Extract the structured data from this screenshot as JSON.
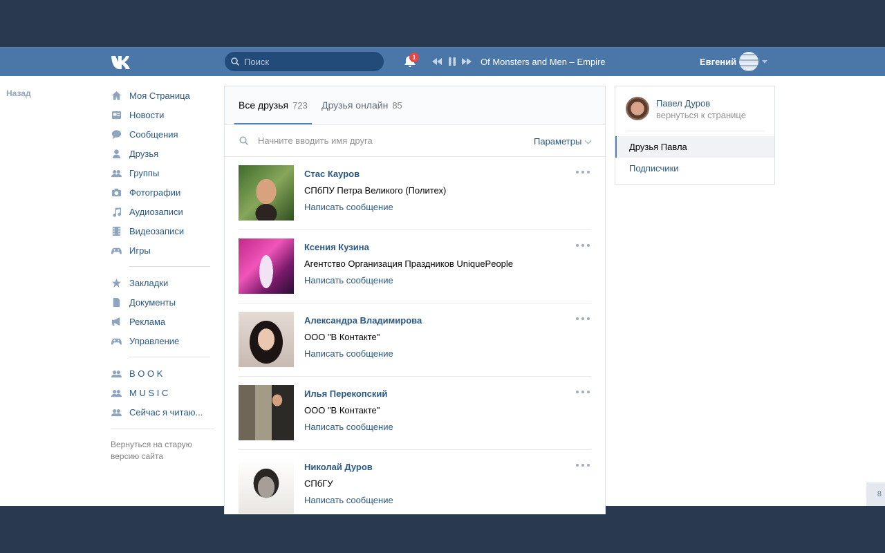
{
  "header": {
    "search_placeholder": "Поиск",
    "notifications_count": "1",
    "now_playing": "Of Monsters and Men – Empire",
    "user_name": "Евгений"
  },
  "back_link": "Назад",
  "sidebar": {
    "main": [
      {
        "label": "Моя Страница",
        "icon": "home-icon"
      },
      {
        "label": "Новости",
        "icon": "news-icon"
      },
      {
        "label": "Сообщения",
        "icon": "messages-icon"
      },
      {
        "label": "Друзья",
        "icon": "friends-icon"
      },
      {
        "label": "Группы",
        "icon": "groups-icon"
      },
      {
        "label": "Фотографии",
        "icon": "camera-icon"
      },
      {
        "label": "Аудиозаписи",
        "icon": "music-note-icon"
      },
      {
        "label": "Видеозаписи",
        "icon": "film-icon"
      },
      {
        "label": "Игры",
        "icon": "gamepad-icon"
      }
    ],
    "secondary": [
      {
        "label": "Закладки",
        "icon": "star-icon"
      },
      {
        "label": "Документы",
        "icon": "document-icon"
      },
      {
        "label": "Реклама",
        "icon": "megaphone-icon"
      },
      {
        "label": "Управление",
        "icon": "gamepad-icon"
      }
    ],
    "groups": [
      {
        "label": "B O O K",
        "icon": "group-icon"
      },
      {
        "label": "M U S I C",
        "icon": "group-icon"
      },
      {
        "label": "Сейчас я читаю...",
        "icon": "group-icon"
      }
    ],
    "old_version": "Вернуться на старую версию сайта"
  },
  "friends": {
    "tabs": [
      {
        "label": "Все друзья",
        "count": "723"
      },
      {
        "label": "Друзья онлайн",
        "count": "85"
      }
    ],
    "filter_placeholder": "Начните вводить имя друга",
    "params_label": "Параметры",
    "items": [
      {
        "name": "Стас Кауров",
        "info": "СПбПУ Петра Великого (Политех)",
        "action": "Написать сообщение"
      },
      {
        "name": "Ксения Кузина",
        "info": "Агентство Организация Праздников UniquePeople",
        "action": "Написать сообщение"
      },
      {
        "name": "Александра Владимирова",
        "info": "ООО \"В Контакте\"",
        "action": "Написать сообщение"
      },
      {
        "name": "Илья Перекопский",
        "info": "ООО \"В Контакте\"",
        "action": "Написать сообщение"
      },
      {
        "name": "Николай Дуров",
        "info": "СПбГУ",
        "action": "Написать сообщение"
      }
    ]
  },
  "right_panel": {
    "owner_name": "Павел Дуров",
    "owner_back": "вернуться к странице",
    "items": [
      "Друзья Павла",
      "Подписчики"
    ]
  },
  "page_number": "8",
  "colors": {
    "header": "#4a76a8",
    "link": "#2a5885",
    "accent": "#5181b8",
    "background": "#293a4f"
  }
}
